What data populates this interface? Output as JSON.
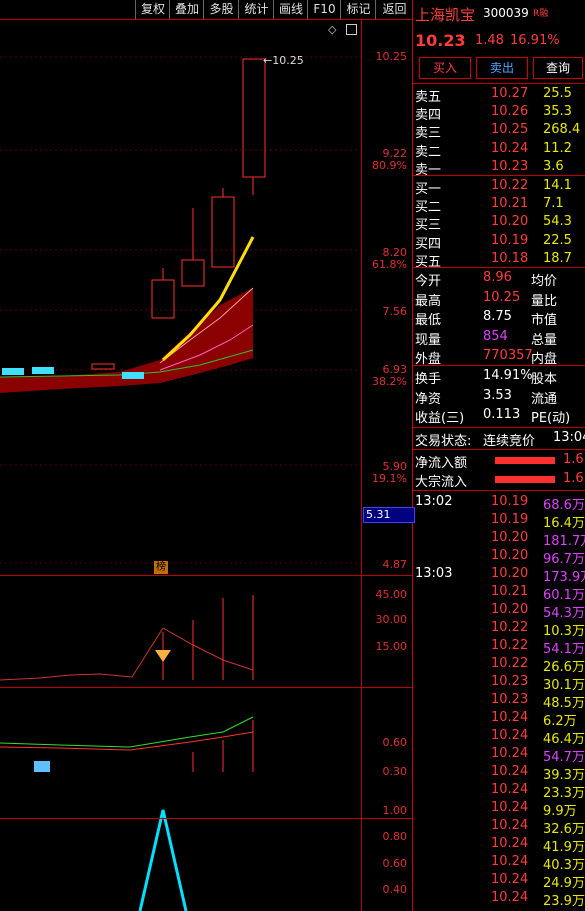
{
  "toolbar": [
    "复权",
    "叠加",
    "多股",
    "统计",
    "画线",
    "F10",
    "标记",
    "返回"
  ],
  "price_axis": {
    "labels": [
      {
        "v": "10.25",
        "pct": ""
      },
      {
        "v": "9.22",
        "pct": "80.9%"
      },
      {
        "v": "8.20",
        "pct": "61.8%"
      },
      {
        "v": "7.56",
        "pct": ""
      },
      {
        "v": "6.93",
        "pct": "38.2%"
      },
      {
        "v": "5.90",
        "pct": "19.1%"
      },
      {
        "v": "5.31",
        "pct": ""
      },
      {
        "v": "4.87",
        "pct": ""
      }
    ],
    "high_marker": "10.25",
    "current_price_box": "5.31",
    "badge": "榜"
  },
  "vol_axis": [
    "45.00",
    "30.00",
    "15.00"
  ],
  "ind1_axis": [
    "0.60",
    "0.30"
  ],
  "ind2_axis": [
    "1.00",
    "0.80",
    "0.60",
    "0.40"
  ],
  "stock": {
    "name": "上海凯宝",
    "code": "300039",
    "tag": "R融",
    "price": "10.23",
    "change": "1.48",
    "pct": "16.91%"
  },
  "actions": {
    "buy": "买入",
    "sell": "卖出",
    "query": "查询"
  },
  "asks": [
    {
      "label": "卖五",
      "price": "10.27",
      "vol": "25.5"
    },
    {
      "label": "卖四",
      "price": "10.26",
      "vol": "35.3"
    },
    {
      "label": "卖三",
      "price": "10.25",
      "vol": "268.4"
    },
    {
      "label": "卖二",
      "price": "10.24",
      "vol": "11.2"
    },
    {
      "label": "卖一",
      "price": "10.23",
      "vol": "3.6"
    }
  ],
  "bids": [
    {
      "label": "买一",
      "price": "10.22",
      "vol": "14.1"
    },
    {
      "label": "买二",
      "price": "10.21",
      "vol": "7.1"
    },
    {
      "label": "买三",
      "price": "10.20",
      "vol": "54.3"
    },
    {
      "label": "买四",
      "price": "10.19",
      "vol": "22.5"
    },
    {
      "label": "买五",
      "price": "10.18",
      "vol": "18.7"
    }
  ],
  "stats1": [
    {
      "l": "今开",
      "v": "8.96",
      "r": "均价",
      "c": "red"
    },
    {
      "l": "最高",
      "v": "10.25",
      "r": "量比",
      "c": "red"
    },
    {
      "l": "最低",
      "v": "8.75",
      "r": "市值",
      "c": "white"
    },
    {
      "l": "现量",
      "v": "854",
      "r": "总量",
      "c": "purple"
    },
    {
      "l": "外盘",
      "v": "770357",
      "r": "内盘",
      "c": "red"
    }
  ],
  "stats2": [
    {
      "l": "换手",
      "v": "14.91%",
      "r": "股本"
    },
    {
      "l": "净资",
      "v": "3.53",
      "r": "流通"
    },
    {
      "l": "收益(三)",
      "v": "0.113",
      "r": "PE(动)"
    }
  ],
  "trade_status": {
    "label": "交易状态:",
    "value": "连续竞价",
    "time": "13:04"
  },
  "flows": [
    {
      "label": "净流入额",
      "value": "1.6"
    },
    {
      "label": "大宗流入",
      "value": "1.6"
    }
  ],
  "ticks": [
    {
      "t": "13:02",
      "p": "10.19",
      "v": "68.6万",
      "c": "purple"
    },
    {
      "t": "",
      "p": "10.19",
      "v": "16.4万",
      "c": "yellow"
    },
    {
      "t": "",
      "p": "10.20",
      "v": "181.7万",
      "c": "purple"
    },
    {
      "t": "",
      "p": "10.20",
      "v": "96.7万",
      "c": "purple"
    },
    {
      "t": "13:03",
      "p": "10.20",
      "v": "173.9万",
      "c": "purple"
    },
    {
      "t": "",
      "p": "10.21",
      "v": "60.1万",
      "c": "purple"
    },
    {
      "t": "",
      "p": "10.20",
      "v": "54.3万",
      "c": "purple"
    },
    {
      "t": "",
      "p": "10.22",
      "v": "10.3万",
      "c": "yellow"
    },
    {
      "t": "",
      "p": "10.22",
      "v": "54.1万",
      "c": "purple"
    },
    {
      "t": "",
      "p": "10.22",
      "v": "26.6万",
      "c": "yellow"
    },
    {
      "t": "",
      "p": "10.23",
      "v": "30.1万",
      "c": "yellow"
    },
    {
      "t": "",
      "p": "10.23",
      "v": "48.5万",
      "c": "yellow"
    },
    {
      "t": "",
      "p": "10.24",
      "v": "6.2万",
      "c": "yellow"
    },
    {
      "t": "",
      "p": "10.24",
      "v": "46.4万",
      "c": "yellow"
    },
    {
      "t": "",
      "p": "10.24",
      "v": "54.7万",
      "c": "purple"
    },
    {
      "t": "",
      "p": "10.24",
      "v": "39.3万",
      "c": "yellow"
    },
    {
      "t": "",
      "p": "10.24",
      "v": "23.3万",
      "c": "yellow"
    },
    {
      "t": "",
      "p": "10.24",
      "v": "9.9万",
      "c": "yellow"
    },
    {
      "t": "",
      "p": "10.24",
      "v": "32.6万",
      "c": "yellow"
    },
    {
      "t": "",
      "p": "10.24",
      "v": "41.9万",
      "c": "yellow"
    },
    {
      "t": "",
      "p": "10.24",
      "v": "40.3万",
      "c": "yellow"
    },
    {
      "t": "",
      "p": "10.24",
      "v": "24.9万",
      "c": "yellow"
    },
    {
      "t": "",
      "p": "10.24",
      "v": "23.9万",
      "c": "yellow"
    }
  ]
}
